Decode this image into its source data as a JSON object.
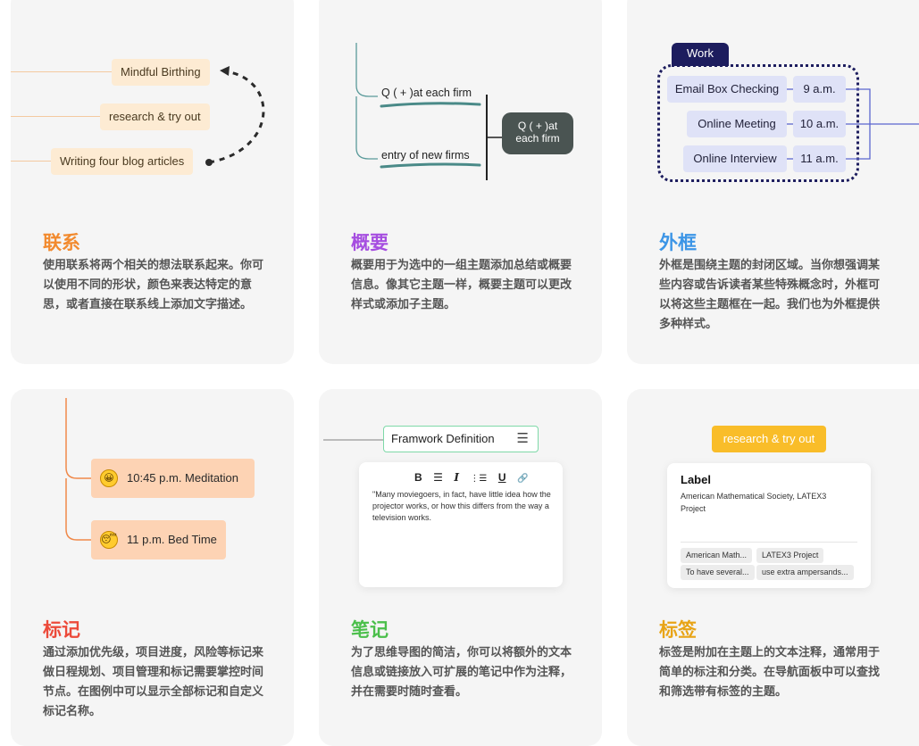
{
  "colors": {
    "card_bg": "#f5f5f5",
    "relationship_title": "#f28a2e",
    "summary_title": "#a64ee0",
    "boundary_title": "#3c95e6",
    "marker_title": "#ec4a3a",
    "note_title": "#4bbf4b",
    "label_title": "#e8a416"
  },
  "cards": {
    "relationship": {
      "title": "联系",
      "description": "使用联系将两个相关的想法联系起来。你可以使用不同的形状，颜色来表达特定的意思，或者直接在联系线上添加文字描述。",
      "topics": [
        "Mindful Birthing",
        "research & try out",
        "Writing four blog articles"
      ]
    },
    "summary": {
      "title": "概要",
      "description": "概要用于为选中的一组主题添加总结或概要信息。像其它主题一样，概要主题可以更改样式或添加子主题。",
      "topics": [
        "Q ( + )at each firm",
        "entry of new firms"
      ],
      "summary_topic": "Q ( + )at each firm"
    },
    "boundary": {
      "title": "外框",
      "description": "外框是围绕主题的封闭区域。当你想强调某些内容或告诉读者某些特殊概念时，外框可以将这些主题框在一起。我们也为外框提供多种样式。",
      "boundary_label": "Work",
      "rows": [
        {
          "task": "Email Box Checking",
          "time": "9 a.m."
        },
        {
          "task": "Online Meeting",
          "time": "10 a.m."
        },
        {
          "task": "Online Interview",
          "time": "11 a.m."
        }
      ]
    },
    "marker": {
      "title": "标记",
      "description": "通过添加优先级，项目进度，风险等标记来做日程规划、项目管理和标记需要掌控时间节点。在图例中可以显示全部标记和自定义标记名称。",
      "items": [
        {
          "text": "10:45 p.m. Meditation",
          "icon": "grin-emoji-icon"
        },
        {
          "text": "11 p.m. Bed Time",
          "icon": "sleepy-emoji-icon"
        }
      ]
    },
    "note": {
      "title": "笔记",
      "description": "为了思维导图的简洁，你可以将额外的文本信息或链接放入可扩展的笔记中作为注释，并在需要时随时查看。",
      "topic": "Framwork Definition",
      "toolbar": [
        "B",
        "☰",
        "I",
        "⋮☰",
        "U",
        "🔗"
      ],
      "note_text": "\"Many moviegoers, in fact, have little idea how the projector works, or how this differs from the way a television works."
    },
    "label": {
      "title": "标签",
      "description": "标签是附加在主题上的文本注释，通常用于简单的标注和分类。在导航面板中可以查找和筛选带有标签的主题。",
      "topic": "research & try out",
      "panel_title": "Label",
      "panel_subtitle": "American Mathematical Society, LATEX3 Project",
      "tags": [
        "American Math...",
        "LATEX3 Project",
        "To have several...",
        "use extra ampersands..."
      ]
    }
  }
}
